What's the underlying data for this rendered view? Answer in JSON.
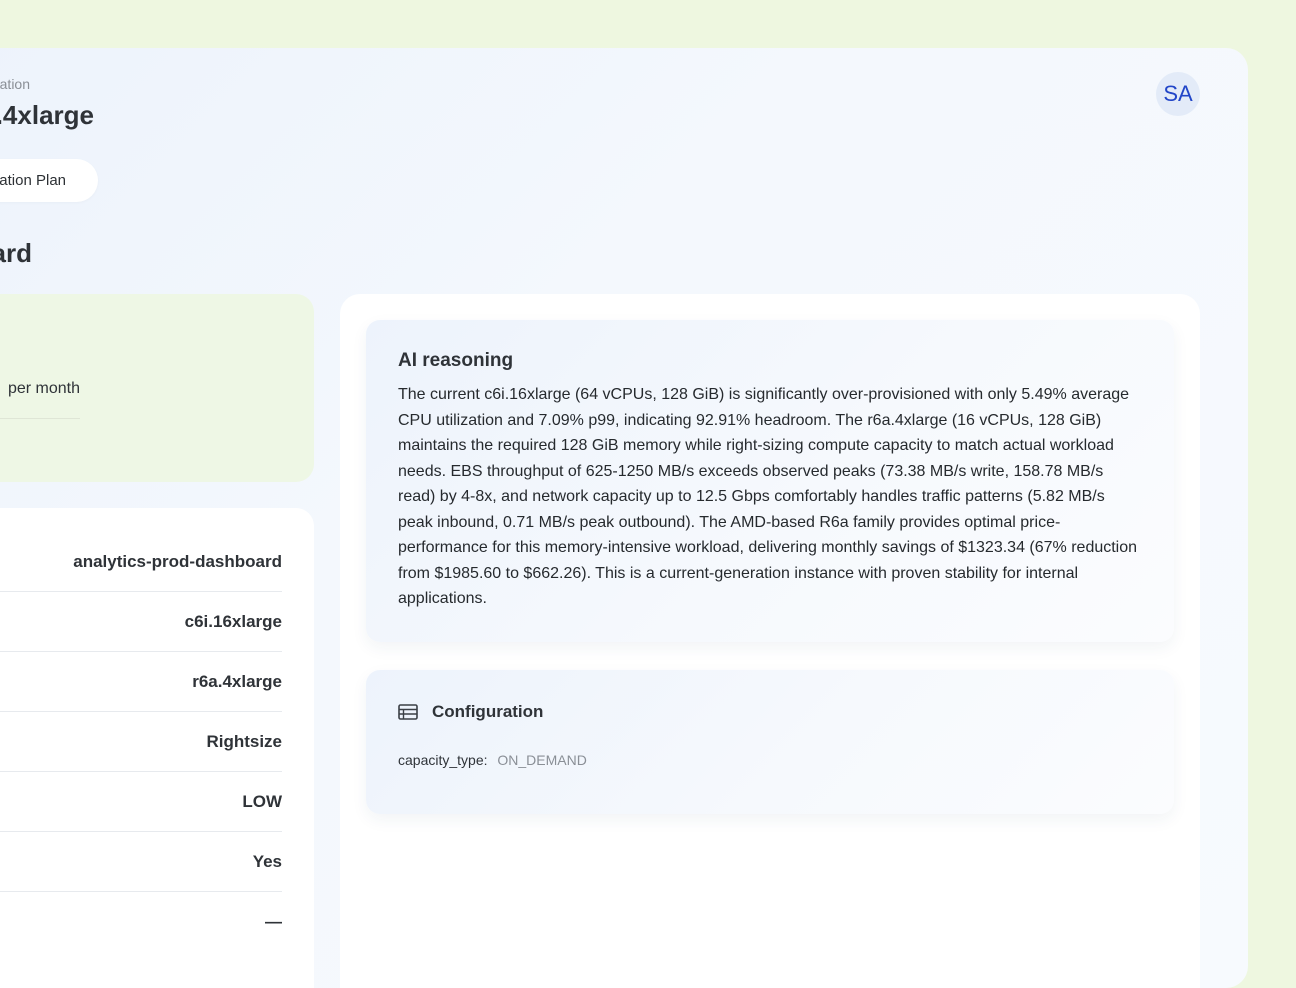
{
  "header": {
    "breadcrumb": "ation",
    "title": ".4xlarge",
    "plan_button_label": "ation Plan",
    "avatar_initials": "SA"
  },
  "section": {
    "title": "ard"
  },
  "savings": {
    "text": "per month"
  },
  "details": {
    "rows": [
      "analytics-prod-dashboard",
      "c6i.16xlarge",
      "r6a.4xlarge",
      "Rightsize",
      "LOW",
      "Yes",
      "—"
    ]
  },
  "reasoning": {
    "title": "AI reasoning",
    "body": "The current c6i.16xlarge (64 vCPUs, 128 GiB) is significantly over-provisioned with only 5.49% average CPU utilization and 7.09% p99, indicating 92.91% headroom. The r6a.4xlarge (16 vCPUs, 128 GiB) maintains the required 128 GiB memory while right-sizing compute capacity to match actual workload needs. EBS throughput of 625-1250 MB/s exceeds observed peaks (73.38 MB/s write, 158.78 MB/s read) by 4-8x, and network capacity up to 12.5 Gbps comfortably handles traffic patterns (5.82 MB/s peak inbound, 0.71 MB/s peak outbound). The AMD-based R6a family provides optimal price-performance for this memory-intensive workload, delivering monthly savings of $1323.34 (67% reduction from $1985.60 to $662.26). This is a current-generation instance with proven stability for internal applications."
  },
  "configuration": {
    "title": "Configuration",
    "icon": "table-list-icon",
    "key": "capacity_type:",
    "value": "ON_DEMAND"
  }
}
